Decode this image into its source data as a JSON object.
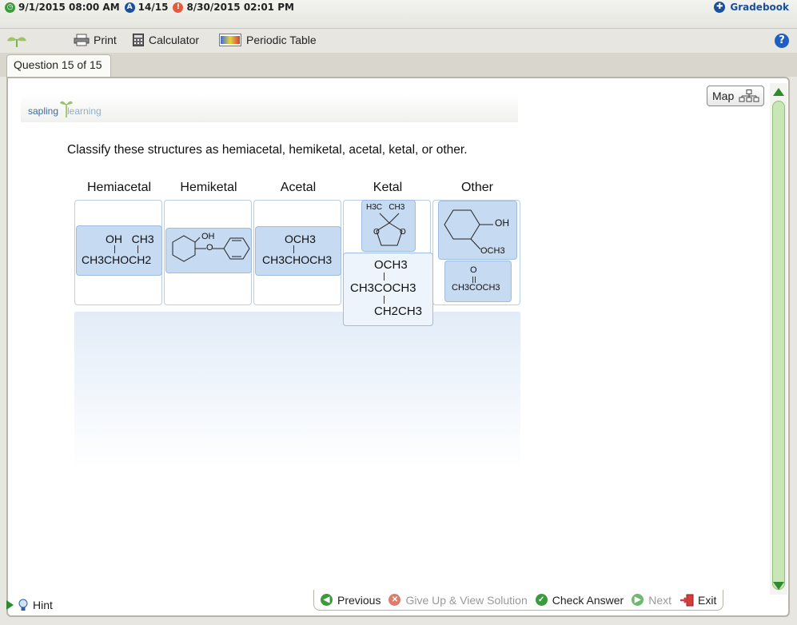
{
  "status": {
    "start": "9/1/2015 08:00 AM",
    "score": "14/15",
    "due": "8/30/2015 02:01 PM",
    "gradebook": "Gradebook"
  },
  "toolbar": {
    "print": "Print",
    "calculator": "Calculator",
    "periodic_table": "Periodic Table",
    "help": "?"
  },
  "tab": {
    "label": "Question 15 of 15"
  },
  "logo": {
    "part1": "sapling",
    "part2": "learning"
  },
  "map": {
    "label": "Map"
  },
  "question": {
    "prompt": "Classify these structures as hemiacetal, hemiketal, acetal, ketal, or other."
  },
  "categories": [
    "Hemiacetal",
    "Hemiketal",
    "Acetal",
    "Ketal",
    "Other"
  ],
  "cards": {
    "hemiacetal": {
      "top": "OH   CH3",
      "bottom": "CH3CHOCH2"
    },
    "hemiketal": {
      "oh": "OH",
      "o": "O"
    },
    "acetal": {
      "top": "OCH3",
      "bottom": "CH3CHOCH3"
    },
    "ketal_ring": {
      "top": "H3C   CH3"
    },
    "ketal_chain": {
      "top": "OCH3",
      "middle": "CH3COCH3",
      "bottom": "CH2CH3"
    },
    "other_ring": {
      "oh": "OH",
      "och3": "OCH3"
    },
    "other_ester": {
      "top": "O",
      "bottom": "CH3COCH3"
    }
  },
  "bottom": {
    "hint": "Hint",
    "previous": "Previous",
    "give_up": "Give Up & View Solution",
    "check": "Check Answer",
    "next": "Next",
    "exit": "Exit"
  },
  "colors": {
    "accent": "#1a4f9c",
    "card": "#c6daf1",
    "scroll": "#c9e6b6"
  }
}
